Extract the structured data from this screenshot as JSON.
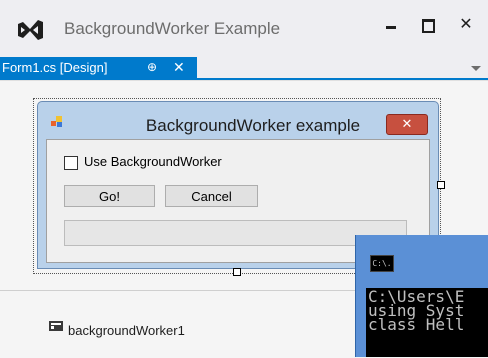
{
  "app": {
    "title": "BackgroundWorker Example",
    "close_glyph": "✕"
  },
  "document_tab": {
    "label": "Form1.cs [Design]",
    "pin_glyph": "⊕",
    "close_glyph": "✕"
  },
  "form": {
    "title": "BackgroundWorker example",
    "close_glyph": "✕",
    "checkbox_label": "Use BackgroundWorker",
    "checkbox_checked": false,
    "go_label": "Go!",
    "cancel_label": "Cancel",
    "progress": 0
  },
  "component_tray": {
    "component_label": "backgroundWorker1"
  },
  "console": {
    "icon_text": "C:\\.",
    "lines": [
      "C:\\Users\\E",
      "using Syst",
      "class Hell"
    ]
  },
  "colors": {
    "accent": "#007acc",
    "form_close": "#c7503f",
    "console_chrome": "#5b90d6"
  }
}
